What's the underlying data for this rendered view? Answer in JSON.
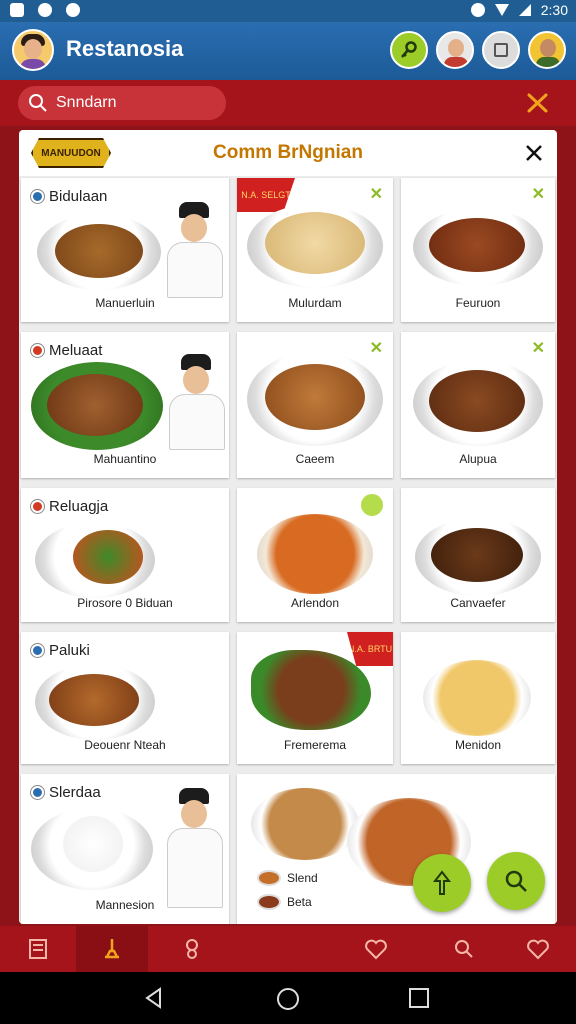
{
  "status": {
    "time": "2:30"
  },
  "app": {
    "title": "Restanosia"
  },
  "search": {
    "placeholder": "Snndarn"
  },
  "panel": {
    "badge": "MANUUDON",
    "title": "Comm BrNgnian"
  },
  "sections": [
    {
      "label": "Bidulaan",
      "color": "#2a6eb1"
    },
    {
      "label": "Meluaat",
      "color": "#d23a24"
    },
    {
      "label": "Reluagja",
      "color": "#d23a24"
    },
    {
      "label": "Paluki",
      "color": "#2a6eb1"
    },
    {
      "label": "Slerdaa",
      "color": "#2a6eb1"
    }
  ],
  "captions": {
    "r1": [
      "Manuerluin",
      "Mulurdam",
      "Feuruon"
    ],
    "r2": [
      "Mahuantino",
      "Caeem",
      "Alupua"
    ],
    "r3": [
      "Pirosore 0 Biduan",
      "Arlendon",
      "Canvaefer"
    ],
    "r4": [
      "Deouenr Nteah",
      "Fremerema",
      "Menidon"
    ],
    "r5": [
      "Mannesion"
    ]
  },
  "ribbons": [
    "N.A. SELGT",
    "N.A. BRTU"
  ],
  "legend": [
    "Slend",
    "Beta"
  ],
  "colors": {
    "primary": "#1f5d92",
    "brand_red": "#a5141b",
    "accent_green": "#9ccc28",
    "title_gold": "#c47700"
  },
  "icons": [
    "search-icon",
    "tools-icon",
    "close-icon",
    "up-arrow-icon",
    "menu-icon",
    "chef-hat-icon",
    "cart-icon",
    "heart-icon",
    "search-nav-icon",
    "heart-outline-icon",
    "back-icon",
    "home-icon",
    "recents-icon"
  ]
}
